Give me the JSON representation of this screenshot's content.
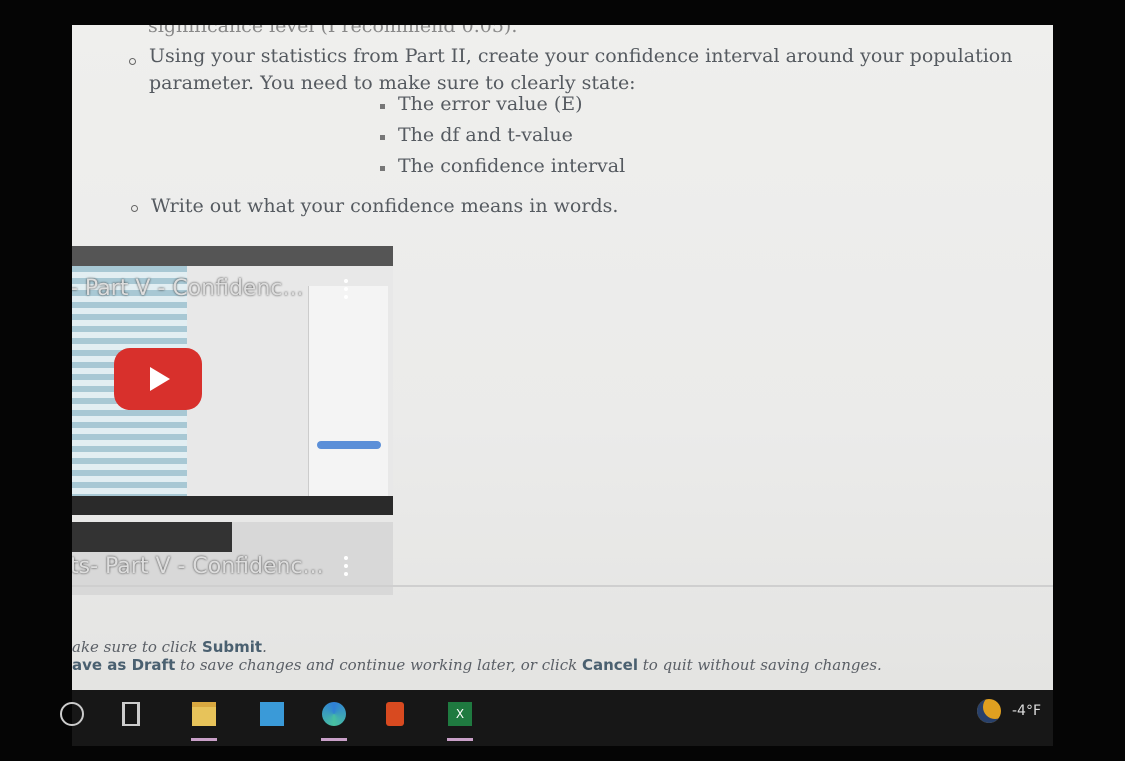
{
  "instructions": {
    "partial_top": "significance level (I recommend 0.05).",
    "bullet1_line1": "Using your statistics from Part II, create your confidence interval around your population",
    "bullet1_line2": "parameter. You need to make sure to clearly state:",
    "sub_items": [
      "The error value (E)",
      "The df and t-value",
      "The confidence interval"
    ],
    "bullet2": "Write out what your confidence means in words."
  },
  "videos": [
    {
      "title": "- Part V - Confidenc..."
    },
    {
      "title": "ts- Part V - Confidenc..."
    }
  ],
  "footer": {
    "line1_pre": "ake sure to click ",
    "line1_bold": "Submit",
    ".": ".",
    "line2_bold1": "ave as Draft",
    "line2_mid": " to save changes and continue working later, or click ",
    "line2_bold2": "Cancel",
    "line2_post": " to quit without saving changes."
  },
  "taskbar": {
    "icons": [
      "search-icon",
      "task-view-icon",
      "file-explorer-icon",
      "mail-icon",
      "edge-icon",
      "office-icon",
      "excel-icon"
    ],
    "weather": "-4°F"
  },
  "colors": {
    "youtube_red": "#d8302c",
    "taskbar": "#171717"
  }
}
